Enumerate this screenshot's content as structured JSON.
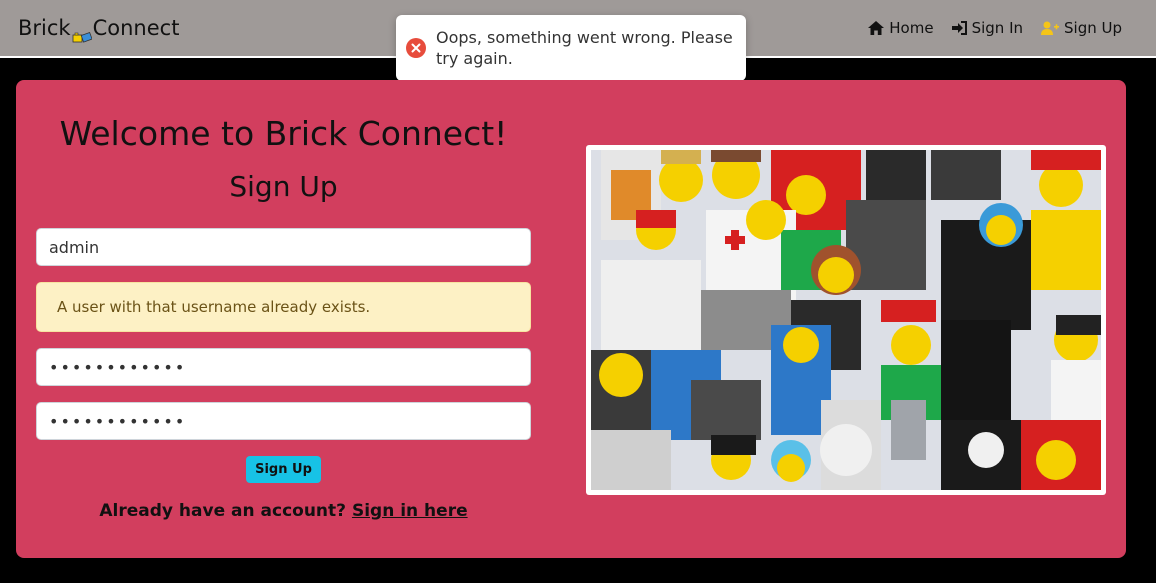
{
  "navbar": {
    "brand_left": "Brick",
    "brand_right": "Connect",
    "links": [
      {
        "label": "Home",
        "icon": "home-icon"
      },
      {
        "label": "Sign In",
        "icon": "sign-in-icon"
      },
      {
        "label": "Sign Up",
        "icon": "user-plus-icon"
      }
    ]
  },
  "toast": {
    "message": "Oops, something went wrong. Please try again.",
    "icon": "error-circle-icon",
    "color": "#e74c3c"
  },
  "form": {
    "welcome": "Welcome to Brick Connect!",
    "title": "Sign Up",
    "username_value": "admin",
    "error_message": "A user with that username already exists.",
    "password_value": "••••••••••••",
    "password_confirm_value": "••••••••••••",
    "submit_label": "Sign Up",
    "signin_prompt": "Already have an account?",
    "signin_link": "Sign in here"
  },
  "colors": {
    "navbar_bg": "#9f9a98",
    "card_bg": "#d23e5e",
    "button_bg": "#17c2e6",
    "alert_bg": "#fdf1c5"
  }
}
